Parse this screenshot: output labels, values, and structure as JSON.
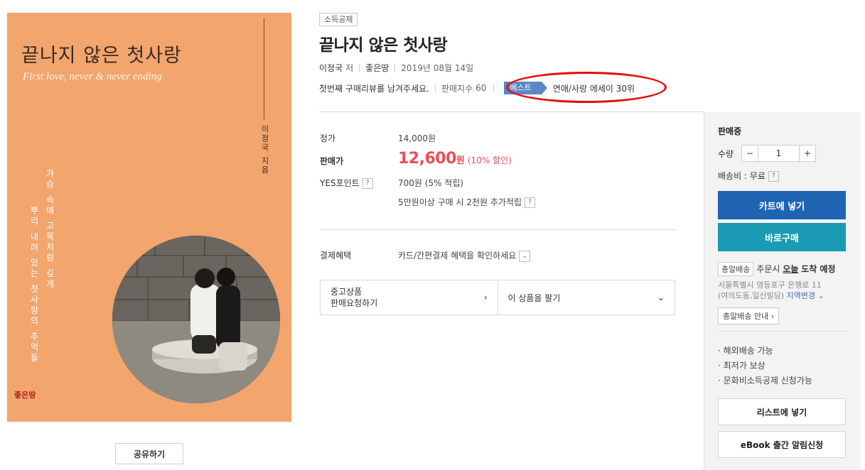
{
  "cover": {
    "title": "끝나지 않은 첫사랑",
    "subtitle": "First love, never & never ending",
    "author_vertical": "이정국 지음",
    "phrase_line1": "가슴 속에 고목처럼 깊게",
    "phrase_line2": "뿌리 내려 있는 첫사랑의 추억들",
    "publisher_logo": "좋은땅",
    "colors": {
      "background": "#f2a56d"
    }
  },
  "share_button": "공유하기",
  "product": {
    "tag": "소득공제",
    "title": "끝나지 않은 첫사랑",
    "author": "이정국",
    "author_suffix": "저",
    "publisher": "좋은땅",
    "pub_date": "2019년 08월 14일",
    "review_prompt": "첫번째 구매리뷰를 남겨주세요.",
    "sales_index_label": "판매지수",
    "sales_index_value": "60",
    "best_label": "베스트",
    "best_rank": "연애/사랑 에세이 30위"
  },
  "pricing": {
    "list_price_label": "정가",
    "list_price": "14,000원",
    "sale_label": "판매가",
    "sale_price": "12,600",
    "sale_unit": "원",
    "discount": "(10% 할인)",
    "points_label": "YES포인트",
    "points_value": "700원 (5% 적립)",
    "points_extra": "5만원이상 구매 시 2천원 추가적립",
    "help_mark": "?"
  },
  "payment": {
    "label": "결제혜택",
    "value": "카드/간편결제 혜택을 확인하세요"
  },
  "used": {
    "request_line1": "중고상품",
    "request_line2": "판매요청하기",
    "sell_label": "이 상품을 팔기"
  },
  "side_panel": {
    "status": "판매중",
    "qty_label": "수량",
    "qty_minus": "−",
    "qty_value": "1",
    "qty_plus": "+",
    "shipping": "배송비 : 무료",
    "cart_button": "카트에 넣기",
    "buy_button": "바로구매",
    "delivery_tag": "총알배송",
    "delivery_prefix": "주문시",
    "delivery_today": "오늘",
    "delivery_rest": "도착 예정",
    "address_line1": "서울특별시 영등포구 은행로 11",
    "address_line2": "(여의도동,일신빌딩)",
    "region_change": "지역변경",
    "delivery_info_button": "총알배송 안내",
    "bullets": [
      "해외배송 가능",
      "최저가 보상",
      "문화비소득공제 신청가능"
    ],
    "wishlist_button": "리스트에 넣기",
    "ebook_button": "eBook 출간 알림신청",
    "colors": {
      "cart": "#1e64b3",
      "buy": "#1a9bb3"
    }
  },
  "annotation": {
    "color": "#e10e0e"
  }
}
